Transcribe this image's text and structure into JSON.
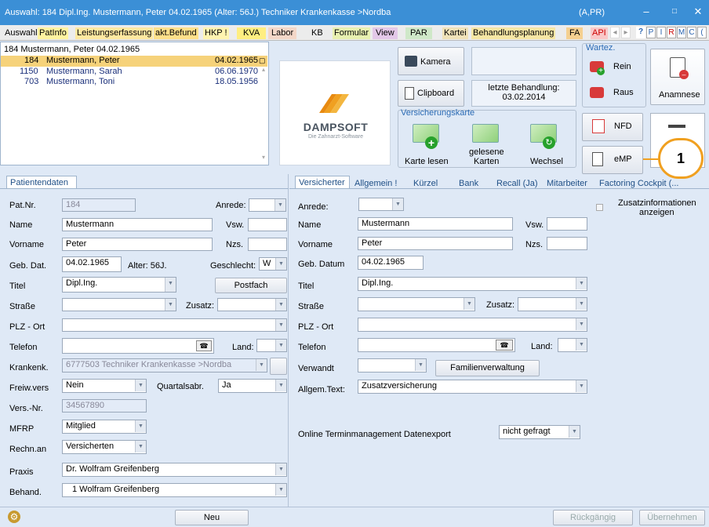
{
  "window": {
    "title": "Auswahl: 184  Dipl.Ing. Mustermann, Peter  04.02.1965 (Alter: 56J.)  Techniker Krankenkasse >Nordba",
    "app_code": "(A,PR)"
  },
  "menu": {
    "items": [
      "Auswahl",
      "PatInfo",
      "Leistungserfassung",
      "akt.Befund",
      "HKP !",
      "KVA",
      "Labor",
      "KB",
      "Formular",
      "View",
      "PAR",
      "Kartei",
      "Behandlungsplanung",
      "FA",
      "API"
    ],
    "letters": [
      "P",
      "I",
      "R",
      "M",
      "C",
      "("
    ]
  },
  "patients": {
    "header": "184 Mustermann, Peter  04.02.1965",
    "rows": [
      {
        "nr": "184",
        "name": "Mustermann, Peter",
        "date": "04.02.1965"
      },
      {
        "nr": "1150",
        "name": "Mustermann, Sarah",
        "date": "06.06.1970"
      },
      {
        "nr": "703",
        "name": "Mustermann, Toni",
        "date": "18.05.1956"
      }
    ]
  },
  "logo": {
    "brand": "DAMPSOFT",
    "tagline": "Die Zahnarzt-Software"
  },
  "tools": {
    "kamera": "Kamera",
    "clipboard": "Clipboard",
    "letzte_label": "letzte Behandlung:",
    "letzte_date": "03.02.2014",
    "versicherungskarte": "Versicherungskarte",
    "karte_lesen": "Karte lesen",
    "gelesene": "gelesene",
    "karten": "Karten",
    "wechsel": "Wechsel",
    "wartez": "Wartez.",
    "rein": "Rein",
    "raus": "Raus",
    "anamnese": "Anamnese",
    "nfd": "NFD",
    "emp": "eMP",
    "callout": "1"
  },
  "left": {
    "tab": "Patientendaten",
    "patnr_label": "Pat.Nr.",
    "patnr": "184",
    "anrede_label": "Anrede:",
    "name_label": "Name",
    "name": "Mustermann",
    "vsw_label": "Vsw.",
    "vorname_label": "Vorname",
    "vorname": "Peter",
    "nzs_label": "Nzs.",
    "gebdat_label": "Geb. Dat.",
    "gebdat": "04.02.1965",
    "alter": "Alter: 56J.",
    "geschlecht_label": "Geschlecht:",
    "geschlecht": "W",
    "titel_label": "Titel",
    "titel": "Dipl.Ing.",
    "postfach": "Postfach",
    "strasse_label": "Straße",
    "zusatz_label": "Zusatz:",
    "plz_label": "PLZ - Ort",
    "telefon_label": "Telefon",
    "land_label": "Land:",
    "krankenk_label": "Krankenk.",
    "krankenk": "6777503 Techniker Krankenkasse >Nordba",
    "freiw_label": "Freiw.vers",
    "freiw": "Nein",
    "quartal_label": "Quartalsabr.",
    "quartal": "Ja",
    "versnr_label": "Vers.-Nr.",
    "versnr": "34567890",
    "mfrp_label": "MFRP",
    "mfrp": "Mitglied",
    "rechn_label": "Rechn.an",
    "rechn": "Versicherten",
    "praxis_label": "Praxis",
    "praxis": "Dr. Wolfram Greifenberg",
    "behand_label": "Behand.",
    "behand": "1 Wolfram Greifenberg"
  },
  "right": {
    "tabs": [
      "Versicherter",
      "Allgemein !",
      "Kürzel",
      "Bank",
      "Recall (Ja)",
      "Mitarbeiter",
      "Factoring Cockpit (..."
    ],
    "anrede_label": "Anrede:",
    "zusatz_info": "Zusatzinformationen",
    "zusatz_info2": "anzeigen",
    "name_label": "Name",
    "name": "Mustermann",
    "vsw_label": "Vsw.",
    "vorname_label": "Vorname",
    "vorname": "Peter",
    "nzs_label": "Nzs.",
    "gebdatum_label": "Geb. Datum",
    "gebdatum": "04.02.1965",
    "titel_label": "Titel",
    "titel": "Dipl.Ing.",
    "strasse_label": "Straße",
    "zusatz_label": "Zusatz:",
    "plz_label": "PLZ - Ort",
    "telefon_label": "Telefon",
    "land_label": "Land:",
    "verwandt_label": "Verwandt",
    "familien": "Familienverwaltung",
    "allgem_label": "Allgem.Text:",
    "allgem": "Zusatzversicherung",
    "online_label": "Online Terminmanagement Datenexport",
    "online": "nicht gefragt"
  },
  "bottom": {
    "neu": "Neu",
    "rueck": "Rückgängig",
    "ueber": "Übernehmen"
  }
}
